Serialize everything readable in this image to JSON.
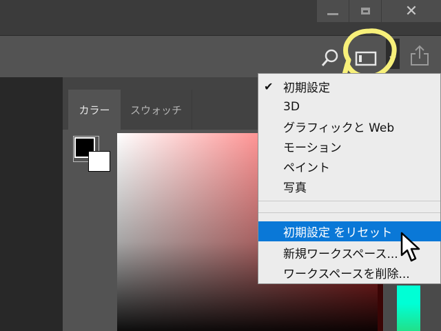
{
  "window": {
    "buttons": [
      {
        "name": "minimize-button"
      },
      {
        "name": "maximize-button"
      },
      {
        "name": "close-button",
        "glyph": "✕"
      }
    ]
  },
  "toolbar": {
    "icons": [
      "search-icon",
      "workspace-icon",
      "chevron-down-icon",
      "share-icon"
    ]
  },
  "panel": {
    "tabs": [
      {
        "label": "カラー",
        "active": true
      },
      {
        "label": "スウォッチ",
        "active": false
      }
    ],
    "foreground_color": "#000000",
    "background_color": "#ffffff",
    "hue_color": "#ff3b3b"
  },
  "workspace_menu": {
    "items": [
      {
        "label": "初期設定",
        "checked": true,
        "check": "✔"
      },
      {
        "label": "3D"
      },
      {
        "label": "グラフィックと Web"
      },
      {
        "label": "モーション"
      },
      {
        "label": "ペイント"
      },
      {
        "label": "写真"
      }
    ],
    "actions": [
      {
        "label": "初期設定 をリセット",
        "highlighted": true
      },
      {
        "label": "新規ワークスペース..."
      },
      {
        "label": "ワークスペースを削除..."
      }
    ]
  },
  "colors": {
    "accent": "#0a78d7",
    "annotation_ring": "#f7f07a"
  }
}
